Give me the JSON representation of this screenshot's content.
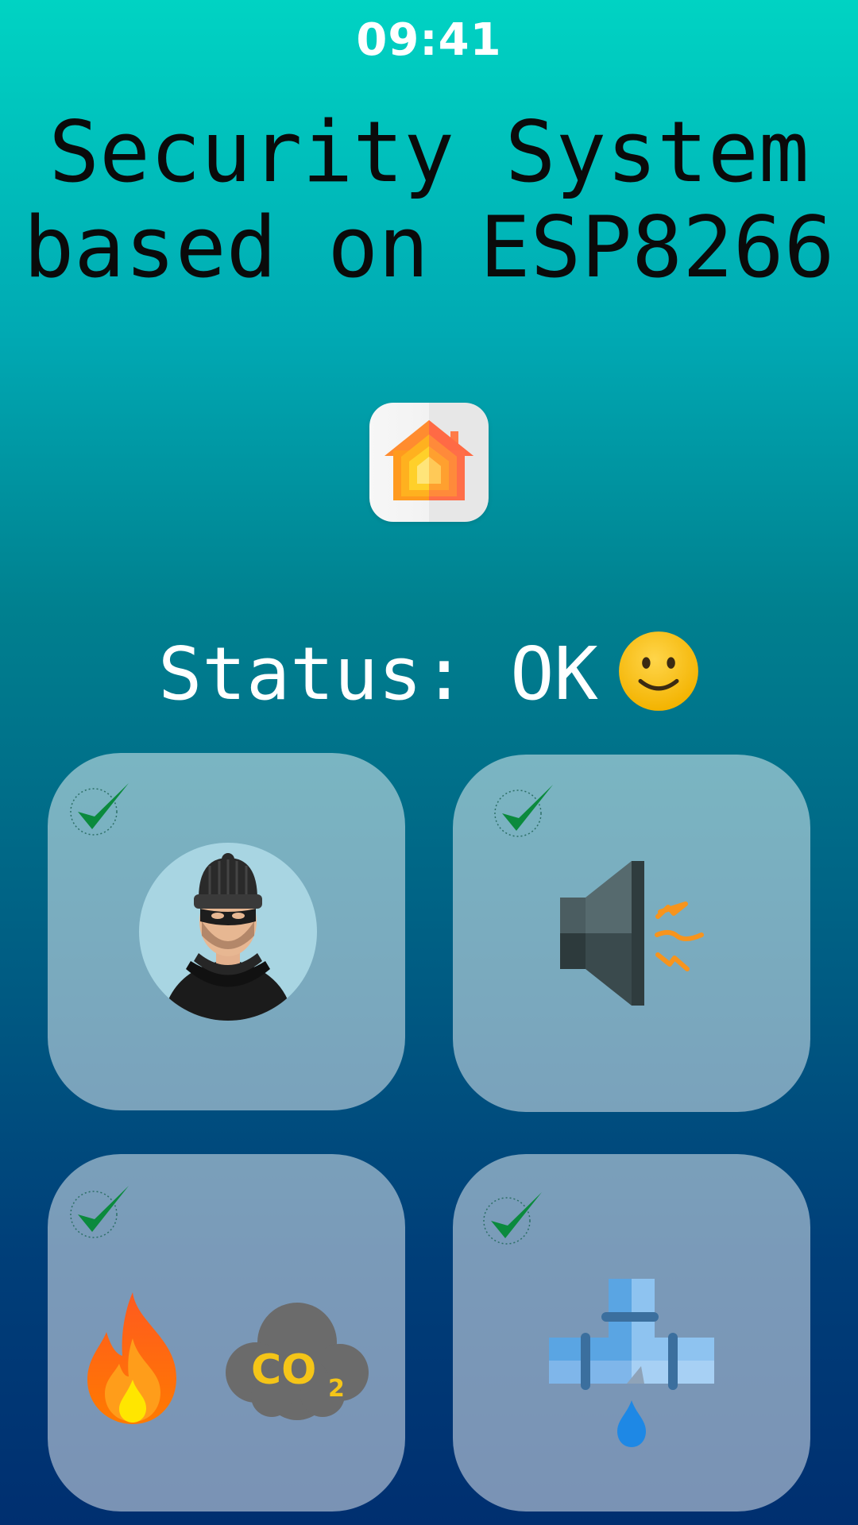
{
  "status_bar": {
    "time": "09:41"
  },
  "header": {
    "title_line1": "Security System",
    "title_line2": "based on ESP8266"
  },
  "app_icon": {
    "name": "home-icon"
  },
  "status": {
    "label": "Status: OK",
    "emoji": "slightly-smiling-face-icon"
  },
  "sensors": [
    {
      "name": "intruder-sensor",
      "icon": "burglar-icon",
      "check": "checkmark-icon",
      "state": "ok"
    },
    {
      "name": "siren",
      "icon": "speaker-icon",
      "check": "checkmark-icon",
      "state": "ok"
    },
    {
      "name": "fire-co2-sensor",
      "icon": "fire-co2-icon",
      "check": "checkmark-icon",
      "state": "ok"
    },
    {
      "name": "water-leak-sensor",
      "icon": "water-leak-pipe-icon",
      "check": "checkmark-icon",
      "state": "ok"
    }
  ],
  "labels": {
    "co2": "CO",
    "co2_sub": "2"
  },
  "colors": {
    "bg_top": "#00d3c3",
    "bg_bottom": "#002f70",
    "check": "#0b8a3d",
    "card": "rgba(255,255,255,0.48)"
  }
}
